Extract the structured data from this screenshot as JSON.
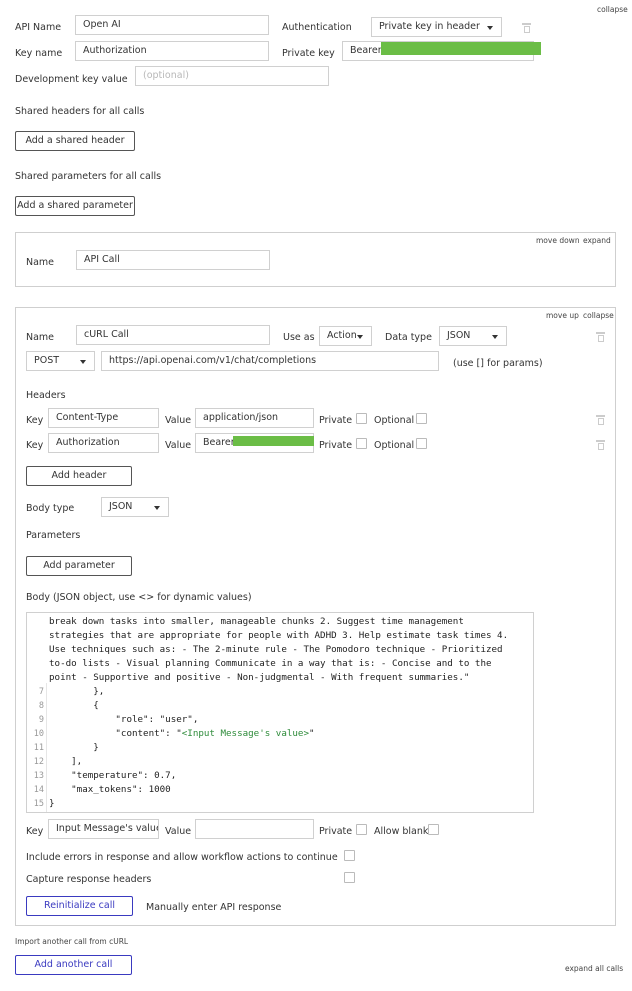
{
  "header": {
    "collapse_link": "collapse"
  },
  "api": {
    "name_label": "API Name",
    "name_value": "Open AI",
    "auth_label": "Authentication",
    "auth_value": "Private key in header",
    "keyname_label": "Key name",
    "keyname_value": "Authorization",
    "privkey_label": "Private key",
    "privkey_value": "Bearer s",
    "devkey_label": "Development key value",
    "devkey_placeholder": "(optional)"
  },
  "shared": {
    "headers_title": "Shared headers for all calls",
    "add_header_btn": "Add a shared header",
    "params_title": "Shared parameters for all calls",
    "add_param_btn": "Add a shared parameter"
  },
  "call1": {
    "move_down": "move down",
    "expand": "expand",
    "name_label": "Name",
    "name_value": "API Call"
  },
  "call2": {
    "move_up": "move up",
    "collapse": "collapse",
    "name_label": "Name",
    "name_value": "cURL Call",
    "use_as_label": "Use as",
    "use_as_value": "Action",
    "data_type_label": "Data type",
    "data_type_value": "JSON",
    "method": "POST",
    "url": "https://api.openai.com/v1/chat/completions",
    "params_hint": "(use [] for params)",
    "headers_title": "Headers",
    "headers": [
      {
        "key_label": "Key",
        "key": "Content-Type",
        "value_label": "Value",
        "value": "application/json",
        "private_label": "Private",
        "optional_label": "Optional"
      },
      {
        "key_label": "Key",
        "key": "Authorization",
        "value_label": "Value",
        "value": "Bearer s",
        "private_label": "Private",
        "optional_label": "Optional"
      }
    ],
    "add_header_btn": "Add header",
    "body_type_label": "Body type",
    "body_type_value": "JSON",
    "parameters_title": "Parameters",
    "add_param_btn": "Add parameter",
    "body_title": "Body (JSON object, use <> for dynamic values)",
    "body_wrapped": [
      "break down tasks into smaller, manageable chunks 2. Suggest time management",
      "strategies that are appropriate for people with ADHD 3. Help estimate task times 4.",
      "Use techniques such as: - The 2-minute rule - The Pomodoro technique - Prioritized",
      "to-do lists - Visual planning Communicate in a way that is: - Concise and to the",
      "point - Supportive and positive - Non-judgmental - With frequent summaries.\""
    ],
    "body_lines": [
      {
        "n": "7",
        "text": "        },",
        "cls": ""
      },
      {
        "n": "8",
        "text": "        {",
        "cls": ""
      },
      {
        "n": "9",
        "text": "            \"role\": \"user\",",
        "cls": ""
      },
      {
        "n": "10",
        "text": "            \"content\": \"",
        "mid": "<Input Message's value>",
        "tail": "\"",
        "cls": "mixed"
      },
      {
        "n": "11",
        "text": "        }",
        "cls": "red"
      },
      {
        "n": "12",
        "text": "    ],",
        "cls": "red"
      },
      {
        "n": "13",
        "text": "    \"temperature\": 0.7,",
        "cls": "red"
      },
      {
        "n": "14",
        "text": "    \"max_tokens\": 1000",
        "cls": "red"
      },
      {
        "n": "15",
        "text": "}",
        "cls": "red"
      }
    ],
    "dyn_key_label": "Key",
    "dyn_key_value": "Input Message's value",
    "dyn_value_label": "Value",
    "dyn_private_label": "Private",
    "dyn_allow_blank_label": "Allow blank",
    "include_errors_label": "Include errors in response and allow workflow actions to continue",
    "capture_headers_label": "Capture response headers",
    "reinit_btn": "Reinitialize call",
    "manual_link": "Manually enter API response"
  },
  "footer": {
    "import_label": "Import another call from cURL",
    "add_call_btn": "Add another call",
    "expand_all": "expand all calls"
  },
  "colors": {
    "accent_blue": "#3a3ac0",
    "redacted_green": "#6bbd46",
    "code_red": "#d23b3b"
  }
}
